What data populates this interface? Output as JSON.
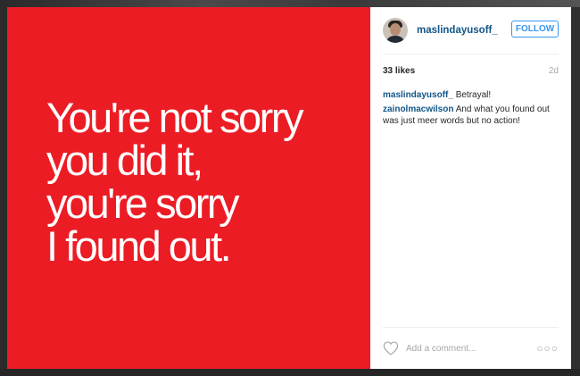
{
  "post": {
    "image_text": "You're not sorry\nyou did it,\nyou're sorry\nI found out.",
    "background_color": "#ec1c24"
  },
  "header": {
    "username": "maslindayusoff_",
    "follow_label": "FOLLOW"
  },
  "stats": {
    "likes": "33 likes",
    "time": "2d"
  },
  "comments": [
    {
      "author": "maslindayusoff_",
      "text": "Betrayal!"
    },
    {
      "author": "zainolmacwilson",
      "text": "And what you found out was just meer words but no action!"
    }
  ],
  "add_comment": {
    "placeholder": "Add a comment...",
    "like_icon": "heart-outline-icon",
    "more_icon": "more-options-icon"
  },
  "colors": {
    "link": "#125688",
    "button": "#3897f0",
    "muted": "#a5a7aa"
  }
}
